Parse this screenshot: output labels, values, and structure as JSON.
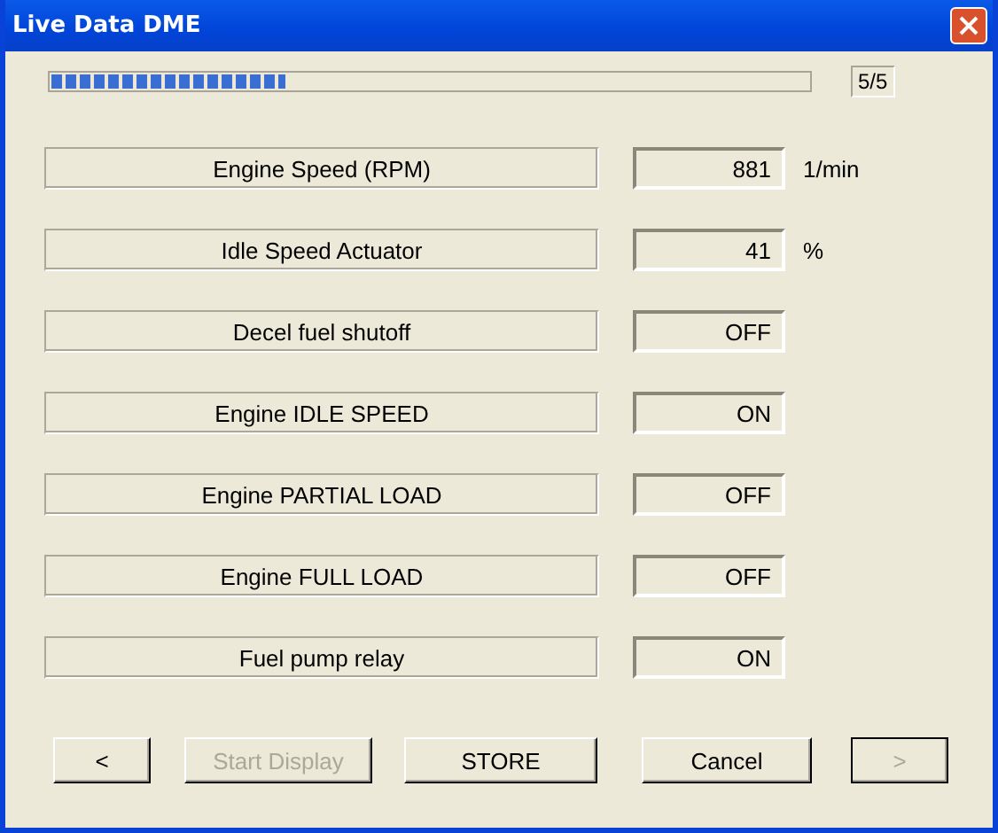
{
  "window": {
    "title": "Live Data DME"
  },
  "progress": {
    "level": 0.31,
    "counter": "5/5"
  },
  "rows": [
    {
      "label": "Engine Speed (RPM)",
      "value": "881",
      "unit": "1/min"
    },
    {
      "label": "Idle Speed Actuator",
      "value": "41",
      "unit": "%"
    },
    {
      "label": "Decel fuel shutoff",
      "value": "OFF"
    },
    {
      "label": "Engine IDLE SPEED",
      "value": "ON"
    },
    {
      "label": "Engine PARTIAL LOAD",
      "value": "OFF"
    },
    {
      "label": "Engine FULL LOAD",
      "value": "OFF"
    },
    {
      "label": "Fuel pump relay",
      "value": "ON"
    }
  ],
  "buttons": [
    {
      "label": "<",
      "disabled": false,
      "default": false
    },
    {
      "label": "Start Display",
      "disabled": true,
      "default": false
    },
    {
      "label": "STORE",
      "disabled": false,
      "default": false
    },
    {
      "label": "Cancel",
      "disabled": false,
      "default": false
    },
    {
      "label": ">",
      "disabled": true,
      "default": true
    }
  ]
}
